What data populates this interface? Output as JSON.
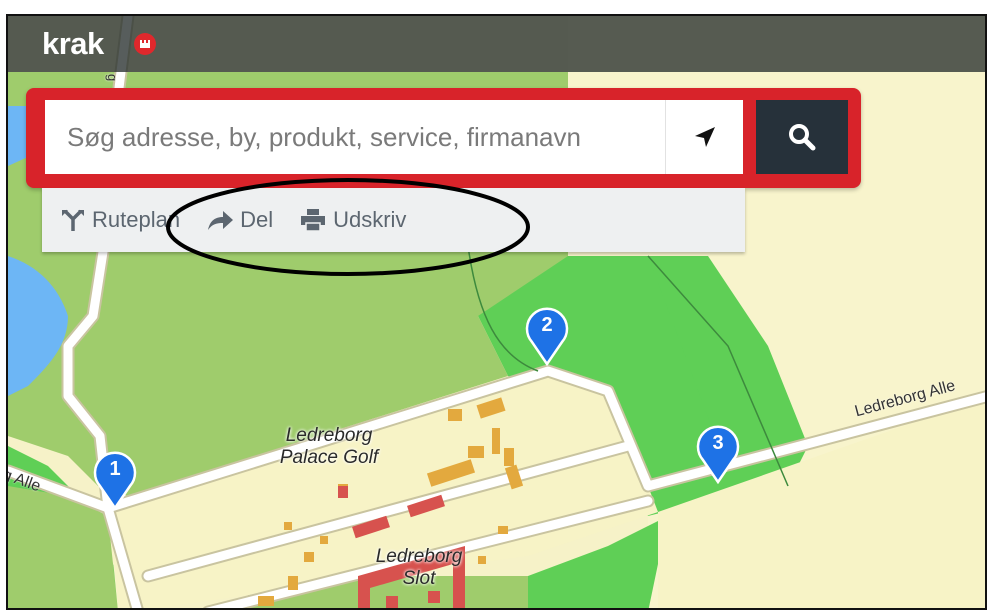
{
  "app": {
    "brand": "krak"
  },
  "search": {
    "placeholder": "Søg adresse, by, produkt, service, firmanavn",
    "value": "",
    "locate_icon": "location-arrow-icon",
    "submit_icon": "search-icon"
  },
  "tools": [
    {
      "label": "Ruteplan",
      "icon": "route-icon"
    },
    {
      "label": "Del",
      "icon": "share-arrow-icon"
    },
    {
      "label": "Udskriv",
      "icon": "printer-icon"
    }
  ],
  "map": {
    "labels": {
      "golf": "Ledreborg\nPalace Golf",
      "slot": "Ledreborg\nSlot",
      "road_right": "Ledreborg Alle",
      "road_left": "g Alle",
      "road_vertical": "g"
    },
    "markers": [
      {
        "number": "1"
      },
      {
        "number": "2"
      },
      {
        "number": "3"
      }
    ]
  },
  "colors": {
    "accent_red": "#d8232a",
    "search_button": "#26313a",
    "marker_blue": "#1e72e6",
    "grass": "#5fcf56",
    "field": "#9fcc6c",
    "water": "#6db6f5",
    "settlement": "#f7f3c6",
    "building": "#e3a93e",
    "building_red": "#d7524e"
  }
}
